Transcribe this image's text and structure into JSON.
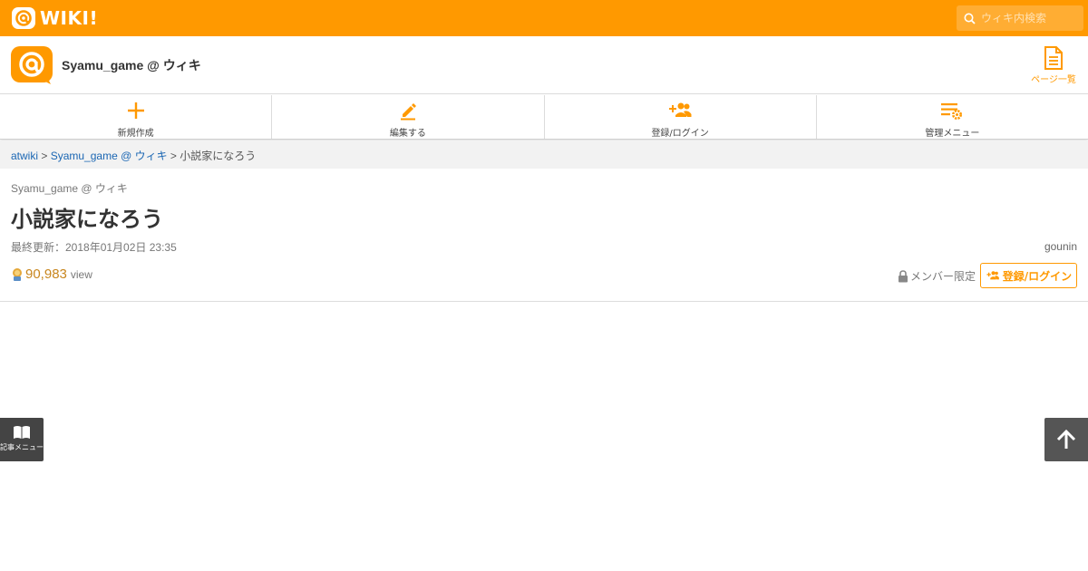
{
  "topbar": {
    "brand_text": "WIKI",
    "brand_exclaim": "!",
    "search_placeholder": "ウィキ内検索",
    "search_value": ""
  },
  "site": {
    "name": "Syamu_game @ ウィキ",
    "pagelist_label": "ページ一覧"
  },
  "nav": {
    "items": [
      {
        "label": "新規作成",
        "icon": "plus-icon"
      },
      {
        "label": "編集する",
        "icon": "pencil-icon"
      },
      {
        "label": "登録/ログイン",
        "icon": "add-user-icon"
      },
      {
        "label": "管理メニュー",
        "icon": "settings-list-icon"
      }
    ]
  },
  "breadcrumb": {
    "root": "atwiki",
    "sep1": " > ",
    "wiki": "Syamu_game @ ウィキ",
    "sep2": " > ",
    "current": "小説家になろう"
  },
  "page": {
    "wiki_name": "Syamu_game @ ウィキ",
    "title": "小説家になろう",
    "updated": "最終更新：2018年01月02日 23:35",
    "author": "gounin",
    "views_count": "90,983",
    "views_unit": "view",
    "member_only": "メンバー限定",
    "login_label": "登録/ログイン"
  },
  "floating": {
    "article_menu_label": "記事メニュー"
  },
  "colors": {
    "brand": "#ff9900",
    "link": "#1a66b3",
    "floating_bg": "#444444"
  }
}
